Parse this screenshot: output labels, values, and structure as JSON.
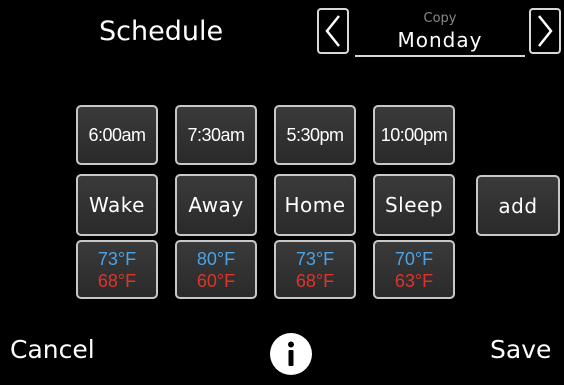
{
  "header": {
    "title": "Schedule",
    "copy_label": "Copy",
    "day": "Monday",
    "prev_icon": "chevron-left-icon",
    "next_icon": "chevron-right-icon"
  },
  "periods": [
    {
      "time": "6:00am",
      "mode": "Wake",
      "cool": "73°F",
      "heat": "68°F"
    },
    {
      "time": "7:30am",
      "mode": "Away",
      "cool": "80°F",
      "heat": "60°F"
    },
    {
      "time": "5:30pm",
      "mode": "Home",
      "cool": "73°F",
      "heat": "68°F"
    },
    {
      "time": "10:00pm",
      "mode": "Sleep",
      "cool": "70°F",
      "heat": "63°F"
    }
  ],
  "add_label": "add",
  "footer": {
    "cancel_label": "Cancel",
    "save_label": "Save",
    "info_icon": "info-icon"
  },
  "colors": {
    "cool": "#4aa3e6",
    "heat": "#e0332b",
    "background": "#000000"
  }
}
